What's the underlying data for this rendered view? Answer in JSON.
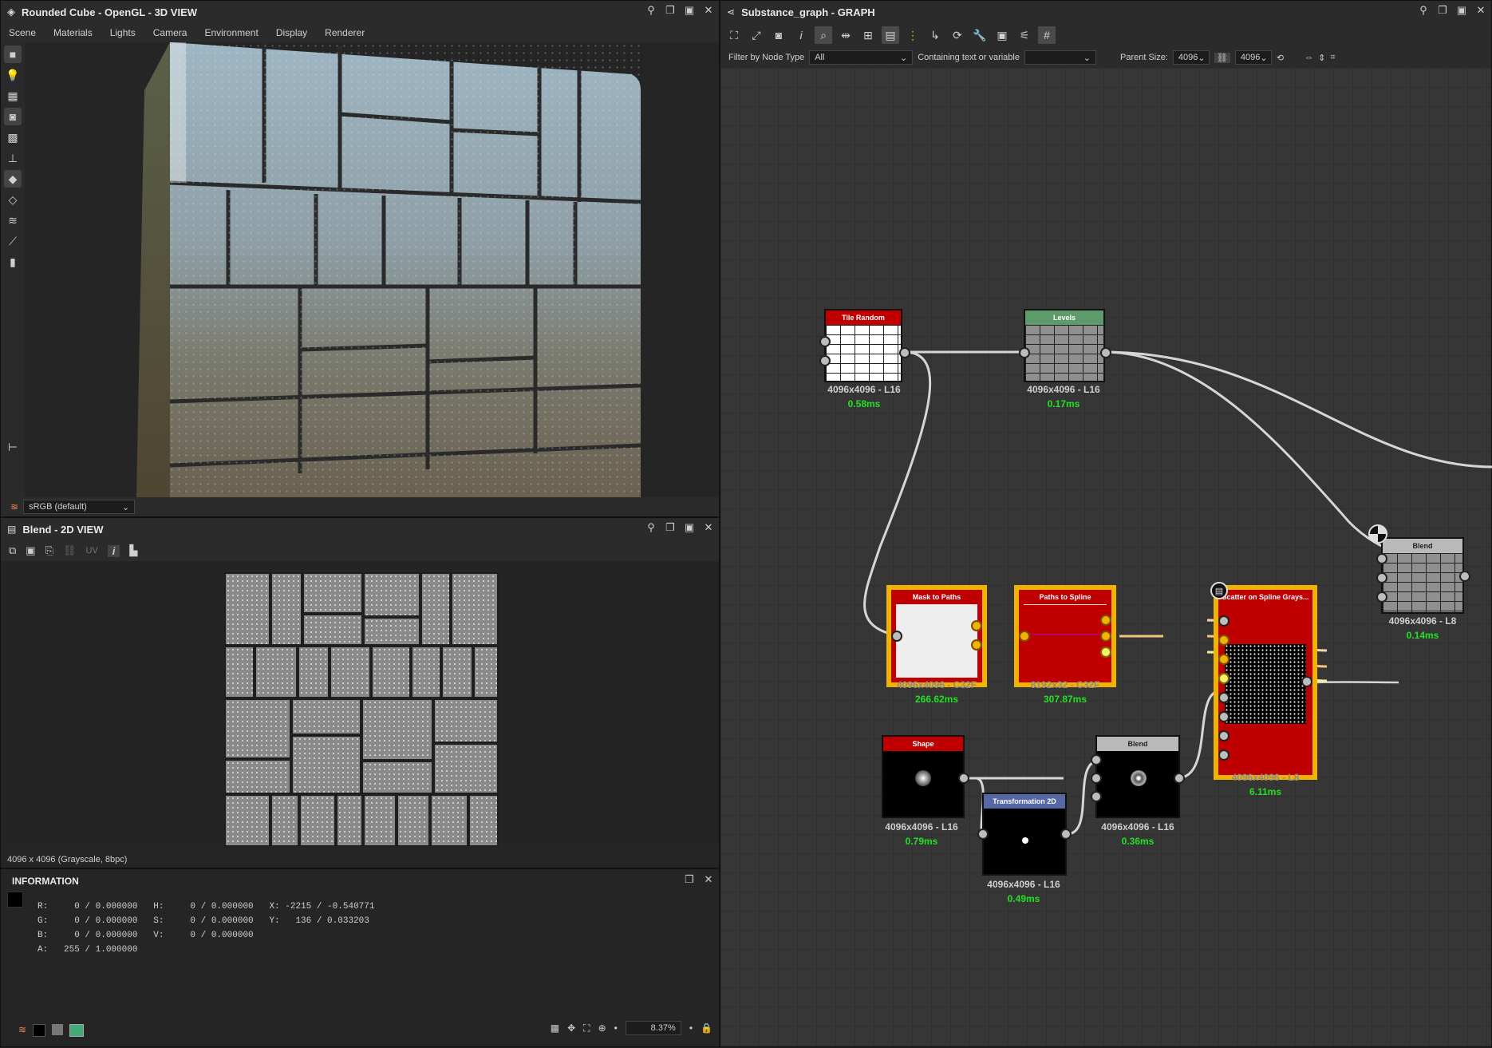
{
  "viewport3d": {
    "title": "Rounded Cube - OpenGL - 3D VIEW",
    "menu": [
      "Scene",
      "Materials",
      "Lights",
      "Camera",
      "Environment",
      "Display",
      "Renderer"
    ],
    "colorspace": "sRGB (default)"
  },
  "view2d": {
    "title": "Blend - 2D VIEW",
    "uv_label": "UV",
    "image_info": "4096 x 4096 (Grayscale, 8bpc)",
    "zoom": "8.37%"
  },
  "information": {
    "title": "INFORMATION",
    "rows": [
      "R:     0 / 0.000000   H:     0 / 0.000000   X: -2215 / -0.540771",
      "G:     0 / 0.000000   S:     0 / 0.000000   Y:   136 / 0.033203",
      "B:     0 / 0.000000   V:     0 / 0.000000",
      "A:   255 / 1.000000"
    ]
  },
  "graph": {
    "title": "Substance_graph - GRAPH",
    "filter_label": "Filter by Node Type",
    "filter_value": "All",
    "containing_label": "Containing text or variable",
    "containing_value": "",
    "parent_size_label": "Parent Size:",
    "parent_size_w": "4096",
    "parent_size_h": "4096",
    "nodes": {
      "tile_random": {
        "name": "Tile Random",
        "res": "4096x4096 - L16",
        "time": "0.58ms"
      },
      "levels": {
        "name": "Levels",
        "res": "4096x4096 - L16",
        "time": "0.17ms"
      },
      "mask_to_paths": {
        "name": "Mask to Paths",
        "res": "4096x4096 - C32F",
        "time": "266.62ms"
      },
      "paths_to_spline": {
        "name": "Paths to Spline",
        "res": "8192x32 - C32F",
        "time": "307.87ms"
      },
      "scatter": {
        "name": "Scatter on Spline Grays...",
        "res": "4096x4096 - L8",
        "time": "6.11ms"
      },
      "blend_main": {
        "name": "Blend",
        "res": "4096x4096 - L8",
        "time": "0.14ms"
      },
      "shape": {
        "name": "Shape",
        "res": "4096x4096 - L16",
        "time": "0.79ms"
      },
      "transformation": {
        "name": "Transformation 2D",
        "res": "4096x4096 - L16",
        "time": "0.49ms"
      },
      "blend_small": {
        "name": "Blend",
        "res": "4096x4096 - L16",
        "time": "0.36ms"
      }
    }
  },
  "colors": {
    "node_red": "#c00000",
    "node_green": "#5e9b6b",
    "node_gray": "#b9b9b9",
    "node_blue": "#5567a4",
    "selection": "#f2b200",
    "time_green": "#24e024"
  }
}
